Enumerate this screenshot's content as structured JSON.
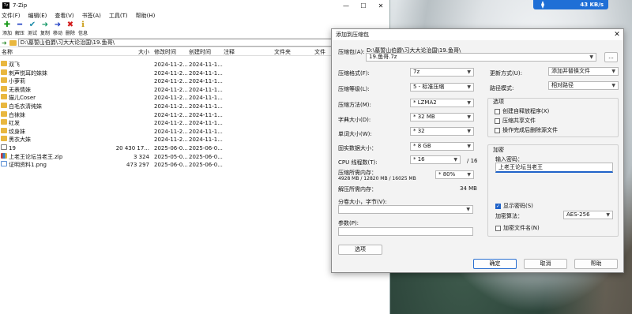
{
  "desktop": {
    "speed": "43 KB/s"
  },
  "main": {
    "title": "7-Zip",
    "menu": [
      "文件(F)",
      "编辑(E)",
      "查看(V)",
      "书签(A)",
      "工具(T)",
      "帮助(H)"
    ],
    "toolbar": [
      {
        "label": "添加",
        "icon": "add-icon",
        "glyph": "✚",
        "color": "#1a9a1a"
      },
      {
        "label": "解压",
        "icon": "extract-icon",
        "glyph": "━",
        "color": "#1f3fc4"
      },
      {
        "label": "测试",
        "icon": "test-icon",
        "glyph": "✔",
        "color": "#1a8aa8"
      },
      {
        "label": "复制",
        "icon": "copy-icon",
        "glyph": "➜",
        "color": "#1a9a6a"
      },
      {
        "label": "移动",
        "icon": "move-icon",
        "glyph": "➜",
        "color": "#1f3fc4"
      },
      {
        "label": "删除",
        "icon": "delete-icon",
        "glyph": "✖",
        "color": "#d21a1a"
      },
      {
        "label": "信息",
        "icon": "info-icon",
        "glyph": "ℹ",
        "color": "#c99a10"
      }
    ],
    "path": "D:\\墓誓山伯爵\\习大大论治国\\19.鱼哥\\",
    "columns": [
      "名称",
      "大小",
      "修改时间",
      "创建时间",
      "注释",
      "文件夹",
      "文件"
    ],
    "rows": [
      {
        "type": "folder",
        "name": "双飞",
        "size": "",
        "modified": "2024-11-2...",
        "created": "2024-11-1..."
      },
      {
        "type": "folder",
        "name": "刺声悦耳的妹妹",
        "size": "",
        "modified": "2024-11-2...",
        "created": "2024-11-1..."
      },
      {
        "type": "folder",
        "name": "小萝莉",
        "size": "",
        "modified": "2024-11-2...",
        "created": "2024-11-1..."
      },
      {
        "type": "folder",
        "name": "无表情妹",
        "size": "",
        "modified": "2024-11-2...",
        "created": "2024-11-1..."
      },
      {
        "type": "folder",
        "name": "猫儿Coser",
        "size": "",
        "modified": "2024-11-2...",
        "created": "2024-11-1..."
      },
      {
        "type": "folder",
        "name": "白毛衣清纯妹",
        "size": "",
        "modified": "2024-11-2...",
        "created": "2024-11-1..."
      },
      {
        "type": "folder",
        "name": "白袜妹",
        "size": "",
        "modified": "2024-11-2...",
        "created": "2024-11-1..."
      },
      {
        "type": "folder",
        "name": "红发",
        "size": "",
        "modified": "2024-11-2...",
        "created": "2024-11-1..."
      },
      {
        "type": "folder",
        "name": "纹身妹",
        "size": "",
        "modified": "2024-11-2...",
        "created": "2024-11-1..."
      },
      {
        "type": "folder",
        "name": "黑衣大妹",
        "size": "",
        "modified": "2024-11-2...",
        "created": "2024-11-1..."
      },
      {
        "type": "file",
        "name": "19",
        "size": "20 430 17...",
        "modified": "2025-06-0...",
        "created": "2025-06-0..."
      },
      {
        "type": "zip",
        "name": "上老王论坛当老王.zip",
        "size": "3 324",
        "modified": "2025-05-0...",
        "created": "2025-06-0..."
      },
      {
        "type": "png",
        "name": "证明资料1.png",
        "size": "473 297",
        "modified": "2025-06-0...",
        "created": "2025-06-0..."
      }
    ]
  },
  "dialog": {
    "title": "添加到压缩包",
    "archive_label": "压缩包(A):",
    "archive_dir": "D:\\墓誓山伯爵\\习大大论治国\\19.鱼哥\\",
    "archive_name": "19.鱼哥.7z",
    "browse": "...",
    "format_label": "压缩格式(F):",
    "format": "7z",
    "level_label": "压缩等级(L):",
    "level": "5 - 标准压缩",
    "method_label": "压缩方法(M):",
    "method": "* LZMA2",
    "dict_label": "字典大小(D):",
    "dict": "* 32 MB",
    "word_label": "单词大小(W):",
    "word": "* 32",
    "solid_label": "固实数据大小：",
    "solid": "* 8 GB",
    "cpu_label": "CPU 线程数(T):",
    "cpu": "* 16",
    "cpu_total": "/ 16",
    "mem_label": "压缩所需内存：",
    "mem_detail": "4928 MB / 12820 MB / 16025 MB",
    "mem": "* 80%",
    "dmem_label": "解压所需内存：",
    "dmem": "34 MB",
    "split_label": "分卷大小，字节(V):",
    "params_label": "参数(P):",
    "options_button": "选项",
    "update_label": "更新方式(U):",
    "update": "添加并替换文件",
    "pathmode_label": "路径模式:",
    "pathmode": "相对路径",
    "options_group": "选项",
    "opt_sfx": "创建自释放程序(X)",
    "opt_shared": "压缩共享文件",
    "opt_delete": "操作完成后删除源文件",
    "encrypt_group": "加密",
    "pw_label": "输入密码：",
    "password": "上老王论坛当老王",
    "show_pw": "显示密码(S)",
    "enc_method_label": "加密算法：",
    "enc_method": "AES-256",
    "enc_names": "加密文件名(N)",
    "ok": "确定",
    "cancel": "取消",
    "help": "帮助"
  }
}
